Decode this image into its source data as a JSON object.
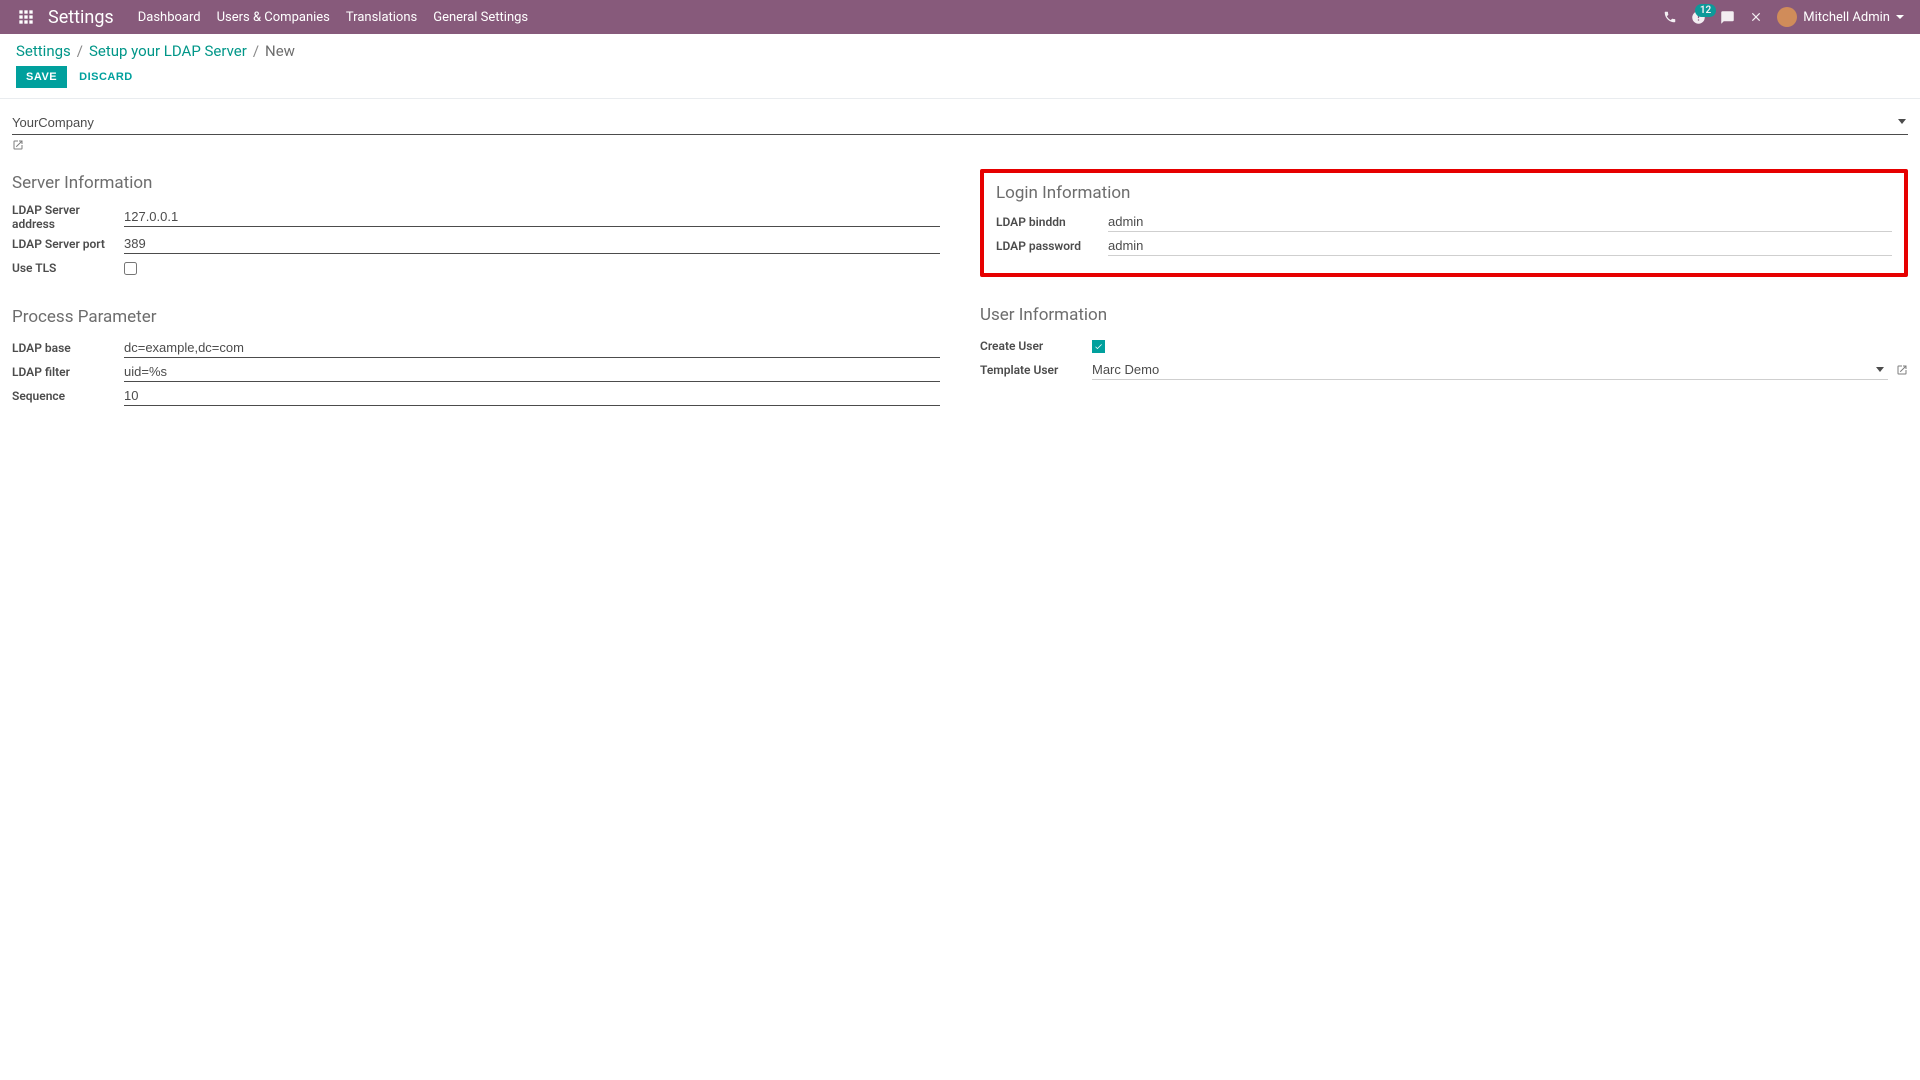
{
  "navbar": {
    "brand": "Settings",
    "items": [
      "Dashboard",
      "Users & Companies",
      "Translations",
      "General Settings"
    ],
    "badge_count": "12",
    "user_name": "Mitchell Admin"
  },
  "breadcrumb": {
    "root": "Settings",
    "mid": "Setup your LDAP Server",
    "current": "New"
  },
  "buttons": {
    "save": "SAVE",
    "discard": "DISCARD"
  },
  "company": {
    "value": "YourCompany"
  },
  "server_info": {
    "title": "Server Information",
    "address_label": "LDAP Server address",
    "address_value": "127.0.0.1",
    "port_label": "LDAP Server port",
    "port_value": "389",
    "tls_label": "Use TLS"
  },
  "login_info": {
    "title": "Login Information",
    "binddn_label": "LDAP binddn",
    "binddn_value": "admin",
    "password_label": "LDAP password",
    "password_value": "admin"
  },
  "process_param": {
    "title": "Process Parameter",
    "base_label": "LDAP base",
    "base_value": "dc=example,dc=com",
    "filter_label": "LDAP filter",
    "filter_value": "uid=%s",
    "sequence_label": "Sequence",
    "sequence_value": "10"
  },
  "user_info": {
    "title": "User Information",
    "create_user_label": "Create User",
    "template_user_label": "Template User",
    "template_user_value": "Marc Demo"
  }
}
